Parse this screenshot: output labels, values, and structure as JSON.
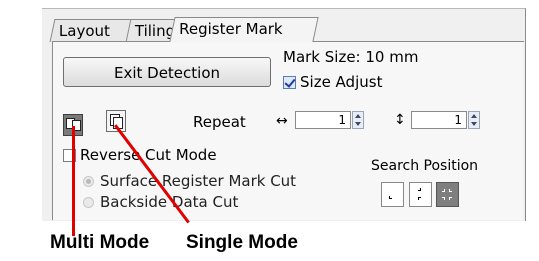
{
  "tabs": [
    {
      "label": "Layout"
    },
    {
      "label": "Tiling"
    },
    {
      "label": "Register Mark"
    }
  ],
  "exit_detection_label": "Exit Detection",
  "mark_size_text": "Mark Size:  10 mm",
  "size_adjust": {
    "label": "Size Adjust",
    "checked": true
  },
  "repeat": {
    "label": "Repeat",
    "horizontal_icon": "↔",
    "vertical_icon": "↕",
    "horizontal_value": "1",
    "vertical_value": "1"
  },
  "reverse_cut": {
    "label": "Reverse Cut Mode",
    "checked": false
  },
  "radios": [
    {
      "label": "Surface Register Mark Cut",
      "selected": true
    },
    {
      "label": "Backside Data Cut",
      "selected": false
    }
  ],
  "search_position_label": "Search Position",
  "captions": {
    "multi": "Multi Mode",
    "single": "Single Mode"
  },
  "colors": {
    "callout_line": "#e00000",
    "selected_button": "#7a7a7a"
  }
}
